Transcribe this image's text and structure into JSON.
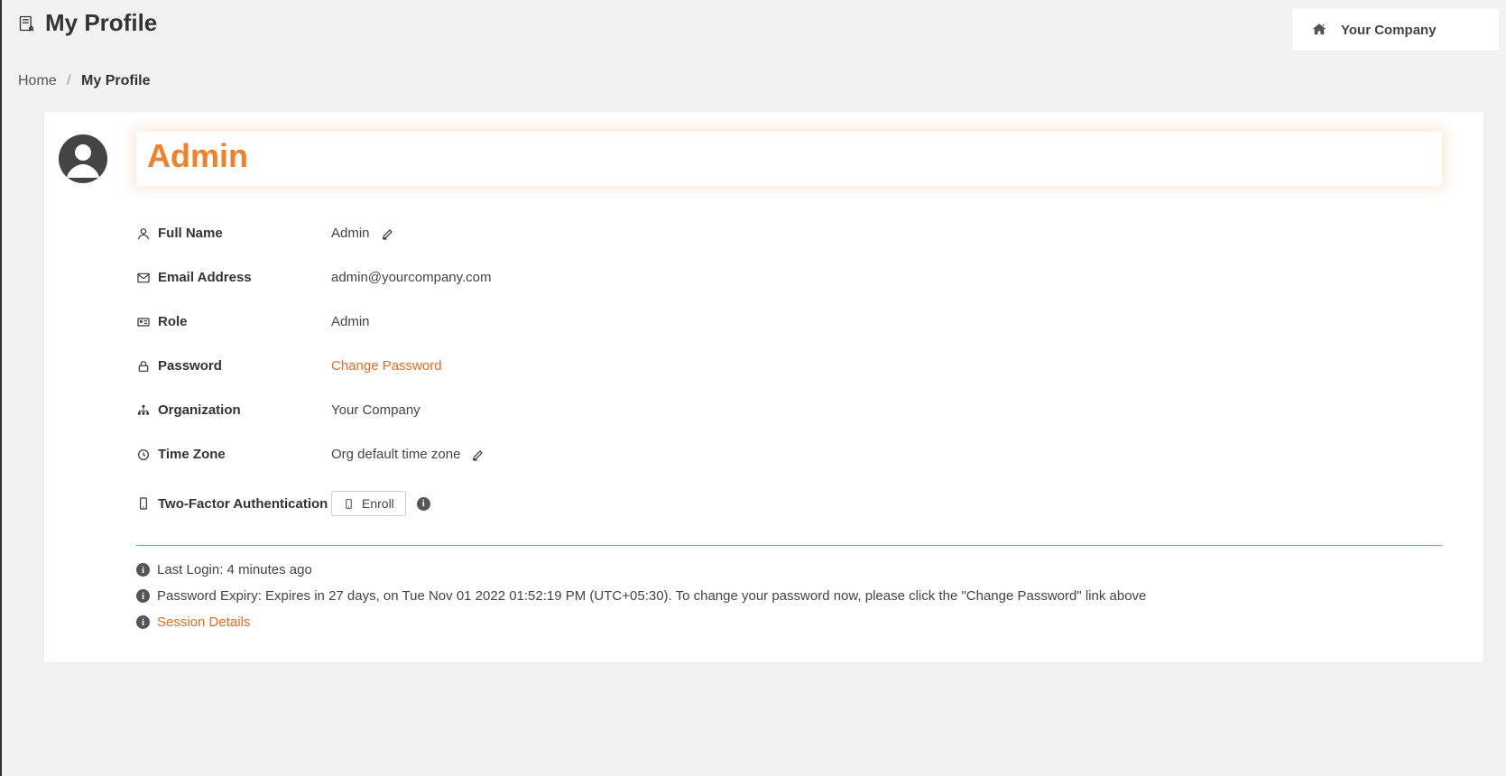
{
  "header": {
    "page_title": "My Profile",
    "company_label": "Your Company"
  },
  "breadcrumb": {
    "home": "Home",
    "current": "My Profile"
  },
  "profile": {
    "display_name": "Admin",
    "fields": {
      "full_name_label": "Full Name",
      "full_name_value": "Admin",
      "email_label": "Email Address",
      "email_value": "admin@yourcompany.com",
      "role_label": "Role",
      "role_value": "Admin",
      "password_label": "Password",
      "change_password_link": "Change Password",
      "organization_label": "Organization",
      "organization_value": "Your Company",
      "timezone_label": "Time Zone",
      "timezone_value": "Org default time zone",
      "tfa_label": "Two-Factor Authentication",
      "enroll_button": "Enroll"
    }
  },
  "info": {
    "last_login": "Last Login: 4 minutes ago",
    "password_expiry": "Password Expiry: Expires in 27 days, on Tue Nov 01 2022 01:52:19 PM (UTC+05:30). To change your password now, please click the \"Change Password\" link above",
    "session_details": "Session Details"
  }
}
